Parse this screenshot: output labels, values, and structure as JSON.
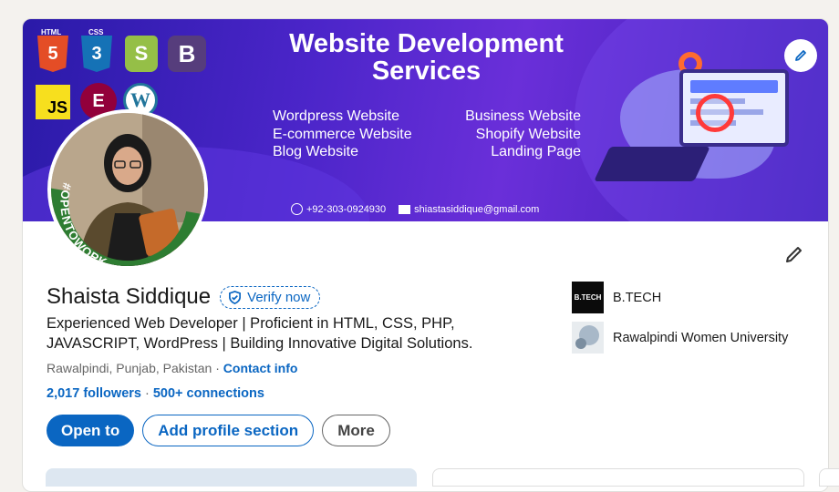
{
  "banner": {
    "title_line1": "Website Development",
    "title_line2": "Services",
    "services_left": [
      "Wordpress Website",
      "E-commerce Website",
      "Blog Website"
    ],
    "services_right": [
      "Business Website",
      "Shopify Website",
      "Landing Page"
    ],
    "phone": "+92-303-0924930",
    "email": "shiastasiddique@gmail.com",
    "logos": {
      "html_tag": "HTML",
      "html": "5",
      "css_tag": "CSS",
      "css": "3",
      "shopify": "S",
      "bootstrap": "B",
      "js": "JS",
      "elementor": "E",
      "wordpress": "W"
    },
    "accent": "#4b25c9"
  },
  "avatar": {
    "badge": "#OPENTOWORK",
    "ring_color": "#2e7d32"
  },
  "profile": {
    "name": "Shaista Siddique",
    "verify_label": "Verify now",
    "headline": "Experienced Web Developer | Proficient in HTML, CSS, PHP, JAVASCRIPT, WordPress | Building Innovative Digital Solutions.",
    "location": "Rawalpindi, Punjab, Pakistan",
    "location_sep": " · ",
    "contact_label": "Contact info",
    "followers": "2,017 followers",
    "stats_sep": " · ",
    "connections": "500+ connections"
  },
  "actions": {
    "open_to": "Open to",
    "add_section": "Add profile section",
    "more": "More"
  },
  "education": [
    {
      "logo_text": "B.TECH",
      "name": "B.TECH"
    },
    {
      "name": "Rawalpindi Women University"
    }
  ],
  "colors": {
    "primary": "#0a66c2",
    "text": "#191919"
  }
}
